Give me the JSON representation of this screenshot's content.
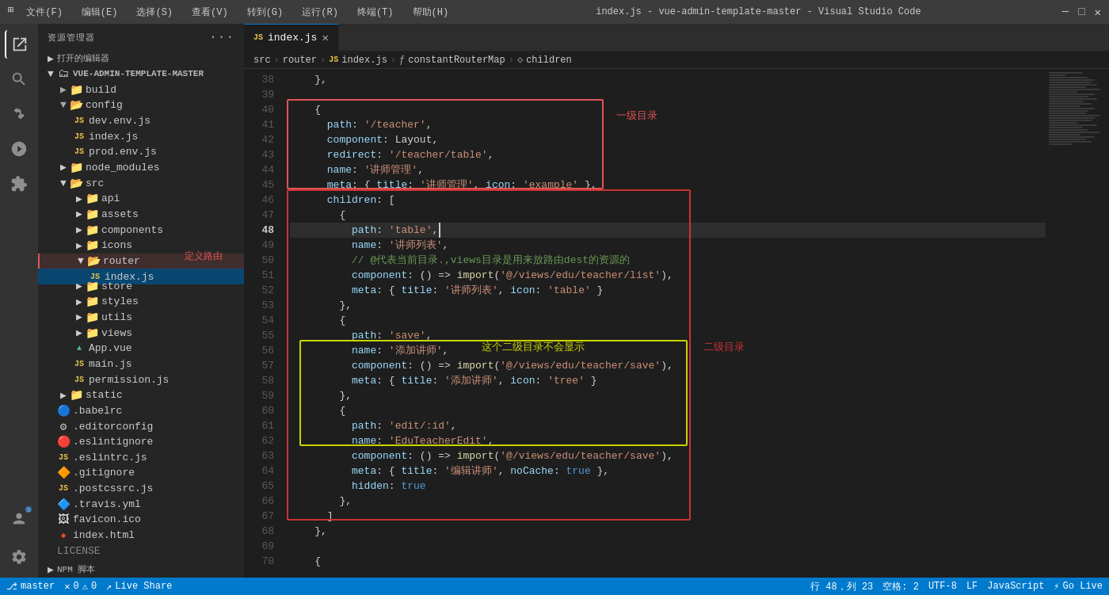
{
  "titlebar": {
    "title": "index.js - vue-admin-template-master - Visual Studio Code",
    "menus": [
      "文件(F)",
      "编辑(E)",
      "选择(S)",
      "查看(V)",
      "转到(G)",
      "运行(R)",
      "终端(T)",
      "帮助(H)"
    ]
  },
  "breadcrumb": {
    "items": [
      "src",
      "router",
      "index.js",
      "constantRouterMap",
      "children"
    ]
  },
  "tab": {
    "name": "index.js",
    "icon": "JS"
  },
  "sidebar": {
    "title": "资源管理器",
    "open_editors": "打开的编辑器",
    "project": "VUE-ADMIN-TEMPLATE-MASTER",
    "define_route_label": "定义路由"
  },
  "annotations": {
    "level1": "一级目录",
    "level2": "二级目录",
    "hidden": "这个二级目录不会显示"
  },
  "statusbar": {
    "errors": "0",
    "warnings": "0",
    "live_share": "Live Share",
    "position": "行 48，列 23",
    "spaces": "空格: 2",
    "encoding": "UTF-8",
    "line_ending": "LF",
    "language": "JavaScript",
    "go_live": "Go Live"
  },
  "code_lines": [
    {
      "num": 38,
      "content": "    },"
    },
    {
      "num": 39,
      "content": ""
    },
    {
      "num": 40,
      "content": "    {"
    },
    {
      "num": 41,
      "content": "      path: '/teacher',"
    },
    {
      "num": 42,
      "content": "      component: Layout,"
    },
    {
      "num": 43,
      "content": "      redirect: '/teacher/table',"
    },
    {
      "num": 44,
      "content": "      name: '讲师管理',"
    },
    {
      "num": 45,
      "content": "      meta: { title: '讲师管理', icon: 'example' },"
    },
    {
      "num": 46,
      "content": "      children: ["
    },
    {
      "num": 47,
      "content": "        {"
    },
    {
      "num": 48,
      "content": "          path: 'table',"
    },
    {
      "num": 49,
      "content": "          name: '讲师列表',"
    },
    {
      "num": 50,
      "content": "          // @代表当前目录.,views目录是用来放路由dest的资源的"
    },
    {
      "num": 51,
      "content": "          component: () => import('@/views/edu/teacher/list'),"
    },
    {
      "num": 52,
      "content": "          meta: { title: '讲师列表', icon: 'table' }"
    },
    {
      "num": 53,
      "content": "        },"
    },
    {
      "num": 54,
      "content": "        {"
    },
    {
      "num": 55,
      "content": "          path: 'save',"
    },
    {
      "num": 56,
      "content": "          name: '添加讲师',"
    },
    {
      "num": 57,
      "content": "          component: () => import('@/views/edu/teacher/save'),"
    },
    {
      "num": 58,
      "content": "          meta: { title: '添加讲师', icon: 'tree' }"
    },
    {
      "num": 59,
      "content": "        },"
    },
    {
      "num": 60,
      "content": "        {"
    },
    {
      "num": 61,
      "content": "          path: 'edit/:id',"
    },
    {
      "num": 62,
      "content": "          name: 'EduTeacherEdit',"
    },
    {
      "num": 63,
      "content": "          component: () => import('@/views/edu/teacher/save'),"
    },
    {
      "num": 64,
      "content": "          meta: { title: '编辑讲师', noCache: true },"
    },
    {
      "num": 65,
      "content": "          hidden: true"
    },
    {
      "num": 66,
      "content": "        },"
    },
    {
      "num": 67,
      "content": "      ]"
    },
    {
      "num": 68,
      "content": "    },"
    },
    {
      "num": 69,
      "content": ""
    },
    {
      "num": 70,
      "content": "    {"
    }
  ]
}
